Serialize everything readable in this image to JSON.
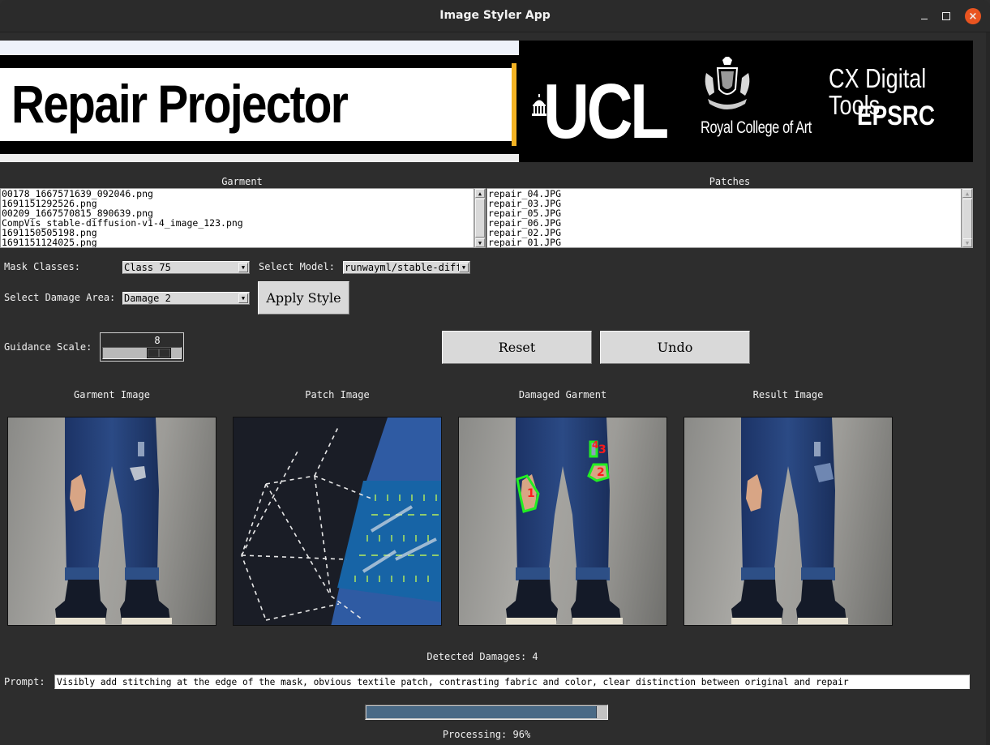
{
  "window": {
    "title": "Image Styler App",
    "controls": {
      "minimize": "minimize",
      "maximize": "maximize",
      "close": "×"
    }
  },
  "banner": {
    "title": "Repair Projector",
    "logos": {
      "ucl": "UCL",
      "rca": "Royal College of Art",
      "cx_line1": "CX Digital Tools",
      "cx_line2": "EPSRC"
    }
  },
  "lists": {
    "garment": {
      "header": "Garment",
      "items": [
        "00178_1667571639_092046.png",
        "1691151292526.png",
        "00209_1667570815_890639.png",
        "CompVis_stable-diffusion-v1-4_image_123.png",
        "1691150505198.png",
        "1691151124025.png"
      ]
    },
    "patches": {
      "header": "Patches",
      "items": [
        "repair_04.JPG",
        "repair_03.JPG",
        "repair_05.JPG",
        "repair_06.JPG",
        "repair_02.JPG",
        "repair_01.JPG"
      ]
    }
  },
  "controls": {
    "mask_classes_label": "Mask Classes:",
    "mask_classes_value": "Class 75",
    "select_model_label": "Select Model:",
    "select_model_value": "runwayml/stable-diff",
    "damage_area_label": "Select Damage Area:",
    "damage_area_value": "Damage 2",
    "apply_style": "Apply Style",
    "guidance_label": "Guidance Scale:",
    "guidance_value": "8",
    "guidance_fraction": 0.7,
    "reset": "Reset",
    "undo": "Undo"
  },
  "panels": [
    {
      "label": "Garment Image"
    },
    {
      "label": "Patch Image"
    },
    {
      "label": "Damaged Garment",
      "damage_markers": [
        "1",
        "2",
        "3",
        "4"
      ]
    },
    {
      "label": "Result Image"
    }
  ],
  "status": {
    "detected_damages": "Detected Damages: 4",
    "prompt_label": "Prompt:",
    "prompt_value": "Visibly add stitching at the edge of the mask, obvious textile patch, contrasting fabric and color, clear distinction between original and repair",
    "progress_percent": 96,
    "processing_text": "Processing: 96%"
  },
  "colors": {
    "background": "#2d2d2d",
    "progress_fill": "#4a6a86",
    "close_button": "#e95420",
    "damage_outline": "#22ee22",
    "damage_label": "#ff1a1a",
    "ucl_gold": "#f4b323"
  }
}
